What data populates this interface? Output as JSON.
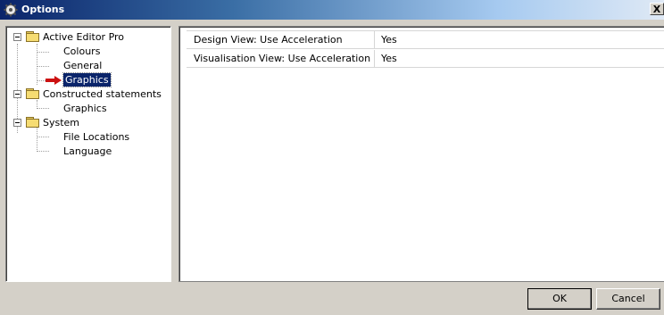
{
  "window": {
    "title": "Options",
    "close_label": "X"
  },
  "tree": {
    "groups": [
      {
        "label": "Active Editor Pro",
        "children": [
          "Colours",
          "General",
          "Graphics"
        ]
      },
      {
        "label": "Constructed statements",
        "children": [
          "Graphics"
        ]
      },
      {
        "label": "System",
        "children": [
          "File Locations",
          "Language"
        ]
      }
    ],
    "selected": "Active Editor Pro / Graphics"
  },
  "properties": [
    {
      "name": "Design View: Use Acceleration",
      "value": "Yes"
    },
    {
      "name": "Visualisation View: Use Acceleration",
      "value": "Yes"
    }
  ],
  "buttons": {
    "ok": "OK",
    "cancel": "Cancel"
  },
  "colors": {
    "selection": "#0a246a",
    "arrow": "#cc1111",
    "folder": "#f6dc72"
  }
}
